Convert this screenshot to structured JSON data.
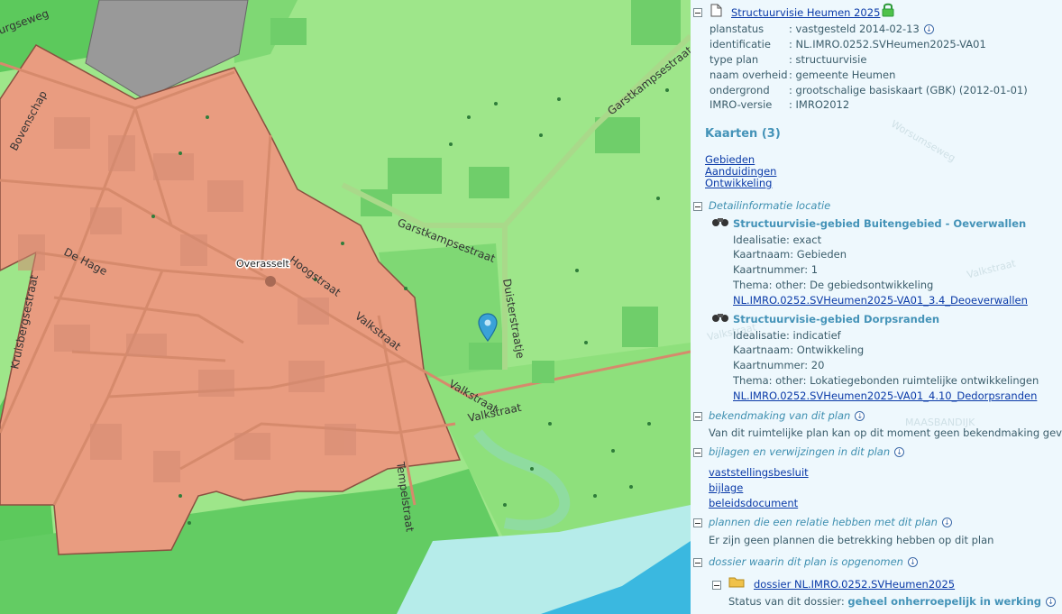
{
  "map": {
    "streets": [
      {
        "text": "Garstkampsestraat"
      },
      {
        "text": "Garstkampsestraat"
      },
      {
        "text": "Hoogstraat"
      },
      {
        "text": "Valkstraat"
      },
      {
        "text": "Valkstraat"
      },
      {
        "text": "Valkstraat"
      },
      {
        "text": "Duisterstraatje"
      },
      {
        "text": "De Hage"
      },
      {
        "text": "Bovenschap"
      },
      {
        "text": "Kruisbergsestraat"
      },
      {
        "text": "Tempelstraat"
      },
      {
        "text": "urgseweg"
      }
    ],
    "place_label": "Overasselt"
  },
  "panel": {
    "plan_title": "Structuurvisie Heumen 2025",
    "meta": [
      {
        "label": "planstatus",
        "value": ": vastgesteld 2014-02-13"
      },
      {
        "label": "identificatie",
        "value": ": NL.IMRO.0252.SVHeumen2025-VA01"
      },
      {
        "label": "type plan",
        "value": ": structuurvisie"
      },
      {
        "label": "naam overheid",
        "value": ": gemeente Heumen"
      },
      {
        "label": "ondergrond",
        "value": ": grootschalige basiskaart (GBK) (2012-01-01)"
      },
      {
        "label": "IMRO-versie",
        "value": ": IMRO2012"
      }
    ],
    "kaarten_heading": "Kaarten (3)",
    "kaarten": [
      "Gebieden",
      "Aanduidingen",
      "Ontwikkeling"
    ],
    "detail_heading": "Detailinformatie locatie",
    "gebieden": [
      {
        "title": "Structuurvisie-gebied Buitengebied - Oeverwallen",
        "lines": [
          "Idealisatie: exact",
          "Kaartnaam: Gebieden",
          "Kaartnummer: 1",
          "Thema: other: De gebiedsontwikkeling"
        ],
        "link": "NL.IMRO.0252.SVHeumen2025-VA01_3.4_Deoeverwallen"
      },
      {
        "title": "Structuurvisie-gebied Dorpsranden",
        "lines": [
          "Idealisatie: indicatief",
          "Kaartnaam: Ontwikkeling",
          "Kaartnummer: 20",
          "Thema: other: Lokatiegebonden ruimtelijke ontwikkelingen"
        ],
        "link": "NL.IMRO.0252.SVHeumen2025-VA01_4.10_Dedorpsranden"
      }
    ],
    "bekend_heading": "bekendmaking van dit plan",
    "bekend_text": "Van dit ruimtelijke plan kan op dit moment geen bekendmaking gevon",
    "bijlagen_heading": "bijlagen en verwijzingen in dit plan",
    "bijlagen": [
      "vaststellingsbesluit",
      "bijlage",
      "beleidsdocument"
    ],
    "relatie_heading": "plannen die een relatie hebben met dit plan",
    "relatie_text": "Er zijn geen plannen die betrekking hebben op dit plan",
    "dossier_heading": "dossier waarin dit plan is opgenomen",
    "dossier_link": "dossier NL.IMRO.0252.SVHeumen2025",
    "dossier_status_label": "Status van dit dossier:",
    "dossier_status_value": "geheel onherroepelijk in werking",
    "ghost_labels": [
      "Worsumseweg",
      "Valkstraat",
      "Valkstraat",
      "MAASBANDIJK"
    ]
  }
}
